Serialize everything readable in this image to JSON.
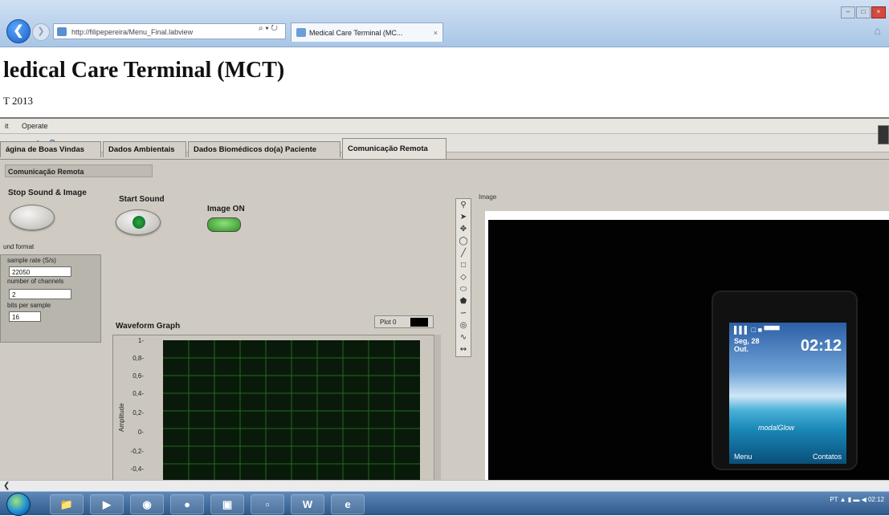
{
  "browser": {
    "address": "http://filipepereira/Menu_Final.labview",
    "search_glyph": "⌕ ▾ ↻",
    "tab_title": "Medical Care Terminal (MC...",
    "tab_close": "×",
    "window_controls": [
      "–",
      "□",
      "×"
    ],
    "icons": [
      "back-arrow-icon",
      "forward-arrow-icon",
      "home-icon"
    ]
  },
  "page": {
    "title": "ledical Care Terminal (MCT)",
    "subtitle": "T 2013"
  },
  "labview": {
    "menu": [
      "it",
      "Operate"
    ],
    "tabs": [
      {
        "label": "ágina de Boas Vindas",
        "active": false
      },
      {
        "label": "Dados Ambientais",
        "active": false
      },
      {
        "label": "Dados Biomédicos do(a) Paciente",
        "active": false
      },
      {
        "label": "Comunicação Remota",
        "active": true
      }
    ],
    "section_label": "Comunicação Remota",
    "controls": {
      "stop_label": "Stop Sound & Image",
      "start_label": "Start Sound",
      "image_on_label": "Image ON"
    },
    "sound_format": {
      "title": "und format",
      "sample_rate_label": "sample rate (S/s)",
      "sample_rate_value": "22050",
      "channels_label": "number of channels",
      "channels_value": "2",
      "bits_label": "bits per sample",
      "bits_value": "16"
    },
    "waveform": {
      "title": "Waveform Graph",
      "legend": "Plot 0",
      "ylabel": "Amplitude",
      "yticks": [
        "1-",
        "0,8-",
        "0,6-",
        "0,4-",
        "0,2-",
        "0-",
        "-0,2-",
        "-0,4-"
      ]
    },
    "image": {
      "label": "Image",
      "phone": {
        "status": "▌▌▌  □                 ■ ▀▀▀",
        "date": "Seg, 28\nOut.",
        "time": "02:12",
        "signature": "modalGlow",
        "soft_left": "Menu",
        "soft_right": "Contatos"
      }
    }
  },
  "colors": {
    "panel": "#d4d0c8",
    "graph_bg": "#0a1a0a",
    "grid": "#1f6a1f",
    "toggle_on": "#2f8f23"
  },
  "taskbar": {
    "tray": "PT  ▲  ▮ ▬ ◀  02:12"
  }
}
